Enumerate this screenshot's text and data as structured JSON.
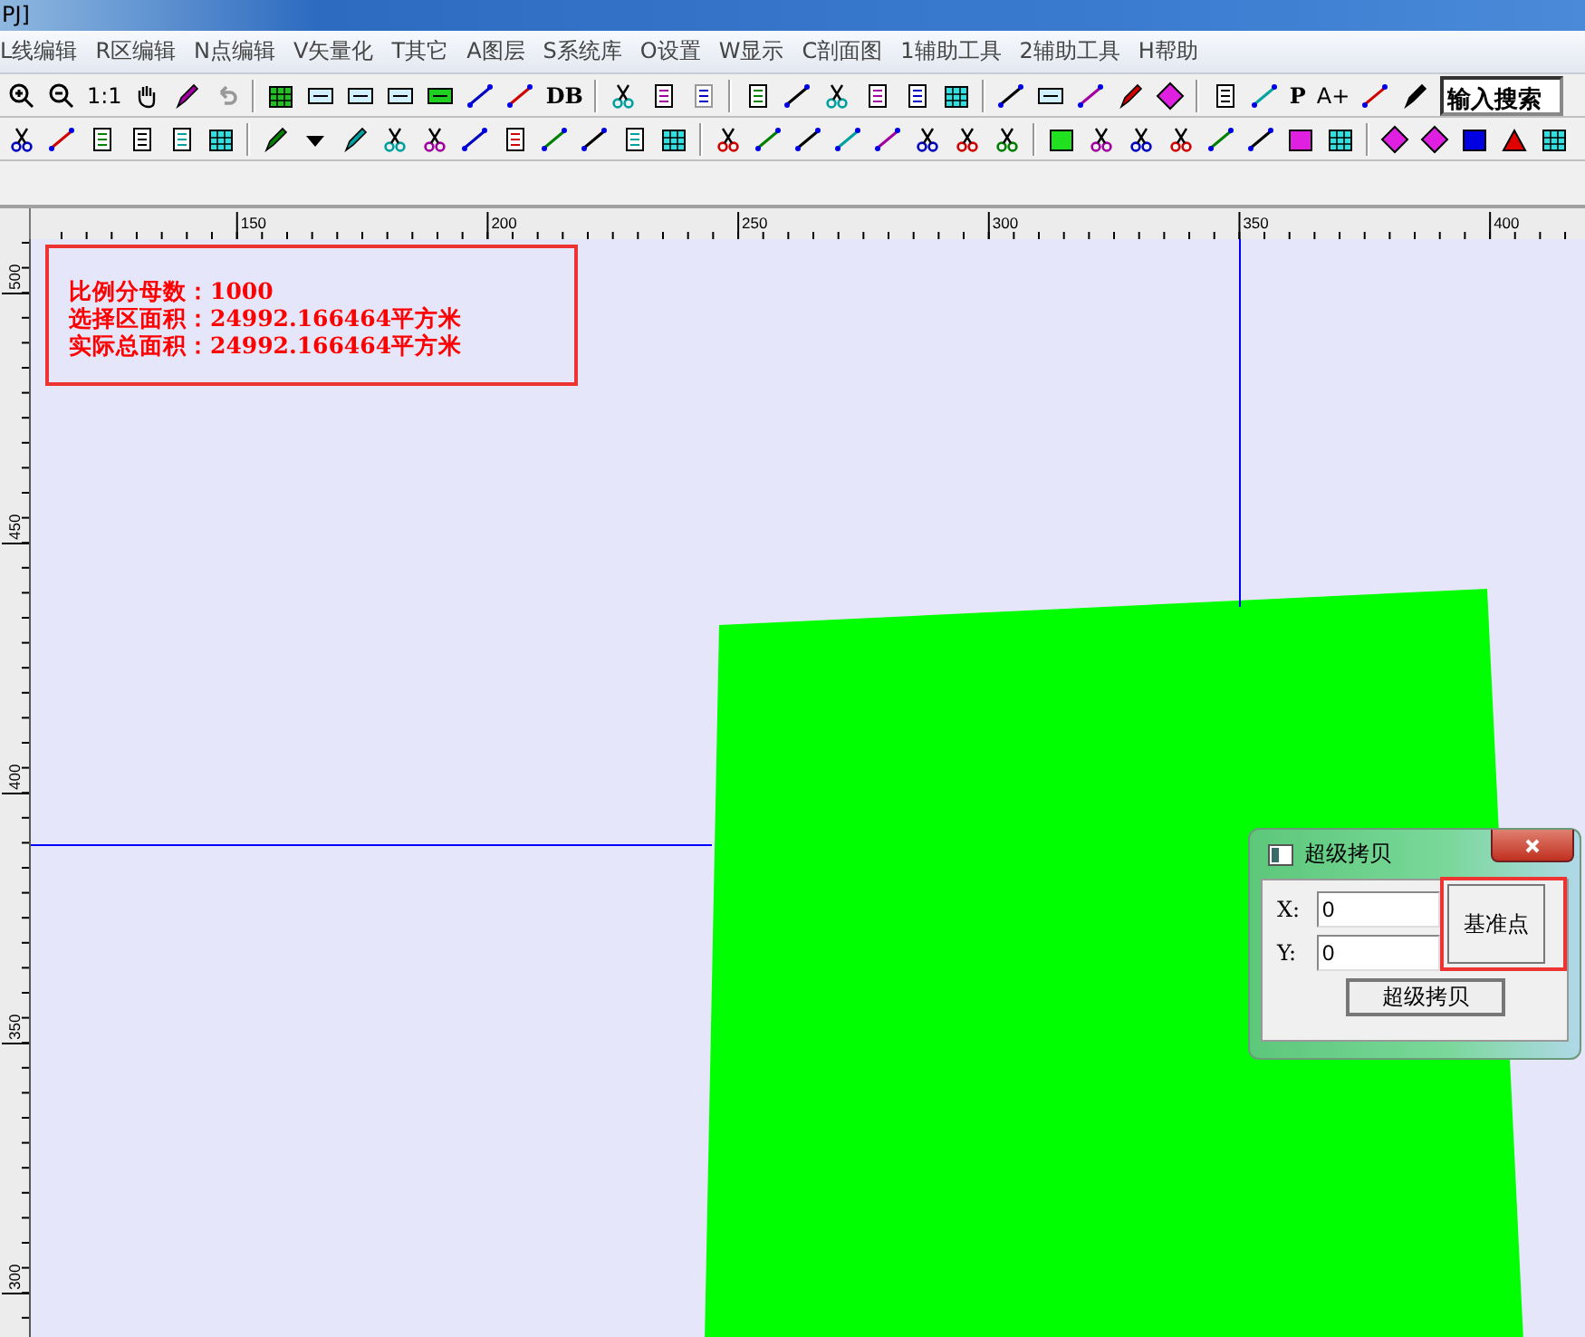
{
  "window": {
    "title": "PJ]"
  },
  "menu": [
    "L线编辑",
    "R区编辑",
    "N点编辑",
    "V矢量化",
    "T其它",
    "A图层",
    "S系统库",
    "O设置",
    "W显示",
    "C剖面图",
    "1辅助工具",
    "2辅助工具",
    "H帮助"
  ],
  "toolbar": {
    "zoom_ratio": "1:1",
    "db": "DB",
    "p": "P",
    "a_plus": "A+",
    "search": "输入搜索"
  },
  "h_ruler": [
    "150",
    "200",
    "250",
    "300",
    "350",
    "400"
  ],
  "v_ruler": [
    "500",
    "450",
    "400",
    "350",
    "300"
  ],
  "info_lines": [
    "比例分母数：1000",
    "选择区面积：24992.166464平方米",
    "实际总面积：24992.166464平方米"
  ],
  "dialog": {
    "title": "超级拷贝",
    "x_label": "X:",
    "x_value": "0",
    "y_label": "Y:",
    "y_value": "0",
    "base_point_button": "基准点",
    "copy_button": "超级拷贝"
  }
}
